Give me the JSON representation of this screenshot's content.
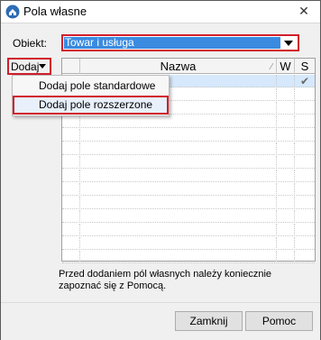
{
  "window": {
    "title": "Pola własne",
    "close_glyph": "✕",
    "app_icon": "app-logo-icon"
  },
  "form": {
    "obiekt_label": "Obiekt:",
    "obiekt_value": "Towar i usługa",
    "dodaj_label": "Dodaj"
  },
  "grid": {
    "columns": [
      "",
      "Nazwa",
      "W",
      "S"
    ],
    "sort_glyph": "∕",
    "rows": [
      {
        "s": "✔",
        "selected": true
      },
      {
        "s": "",
        "selected": false
      },
      {
        "s": "",
        "selected": false
      },
      {
        "s": "",
        "selected": false
      },
      {
        "s": "",
        "selected": false
      },
      {
        "s": "",
        "selected": false
      },
      {
        "s": "",
        "selected": false
      },
      {
        "s": "",
        "selected": false
      },
      {
        "s": "",
        "selected": false
      },
      {
        "s": "",
        "selected": false
      },
      {
        "s": "",
        "selected": false
      },
      {
        "s": "",
        "selected": false
      },
      {
        "s": "",
        "selected": false
      },
      {
        "s": "",
        "selected": false
      }
    ]
  },
  "menu": {
    "items": [
      "Dodaj pole standardowe",
      "Dodaj pole rozszerzone"
    ]
  },
  "info_text": "Przed dodaniem pól własnych należy koniecznie zapoznać się z Pomocą.",
  "buttons": {
    "close": "Zamknij",
    "help": "Pomoc"
  },
  "colors": {
    "highlight": "#d21e2b",
    "selection": "#3a8be0"
  }
}
